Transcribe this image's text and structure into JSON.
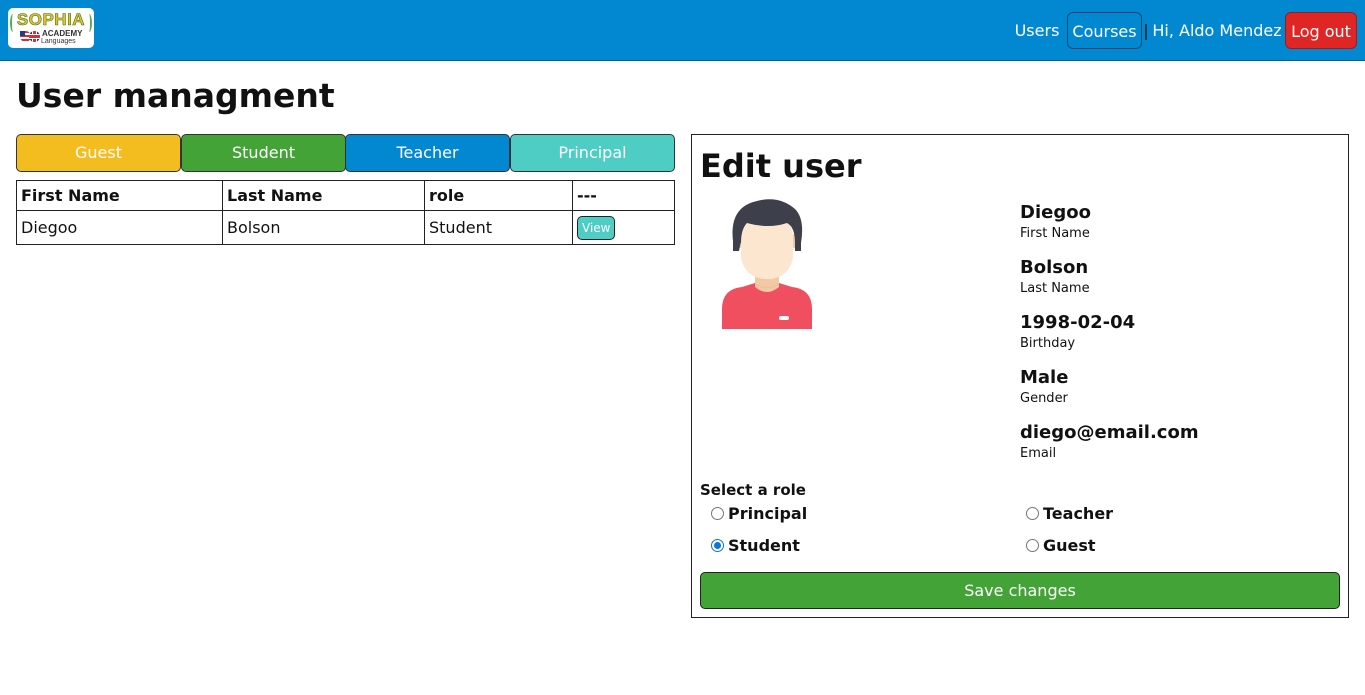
{
  "navbar": {
    "logo": {
      "text": "SOPHIA",
      "subtext": "ACADEMY",
      "tagline": "Languages"
    },
    "users_label": "Users",
    "courses_label": "Courses",
    "separator": "|",
    "greeting": "Hi, Aldo Mendez",
    "logout_label": "Log out",
    "colors": {
      "bar": "#0288d1",
      "logout": "#e02525"
    }
  },
  "page": {
    "title": "User managment"
  },
  "filters": [
    {
      "label": "Guest",
      "color": "#f4bd1f"
    },
    {
      "label": "Student",
      "color": "#43a336"
    },
    {
      "label": "Teacher",
      "color": "#0288d1"
    },
    {
      "label": "Principal",
      "color": "#4ecdc4"
    }
  ],
  "table": {
    "headers": [
      "First Name",
      "Last Name",
      "role",
      "---"
    ],
    "rows": [
      {
        "first_name": "Diegoo",
        "last_name": "Bolson",
        "role": "Student",
        "action": "View"
      }
    ]
  },
  "edit_user": {
    "title": "Edit user",
    "avatar_icon": "user-avatar-icon",
    "fields": [
      {
        "value": "Diegoo",
        "label": "First Name"
      },
      {
        "value": "Bolson",
        "label": "Last Name"
      },
      {
        "value": "1998-02-04",
        "label": "Birthday"
      },
      {
        "value": "Male",
        "label": "Gender"
      },
      {
        "value": "diego@email.com",
        "label": "Email"
      }
    ],
    "role_title": "Select a role",
    "roles": [
      {
        "label": "Principal",
        "checked": false
      },
      {
        "label": "Teacher",
        "checked": false
      },
      {
        "label": "Student",
        "checked": true
      },
      {
        "label": "Guest",
        "checked": false
      }
    ],
    "save_label": "Save changes"
  }
}
